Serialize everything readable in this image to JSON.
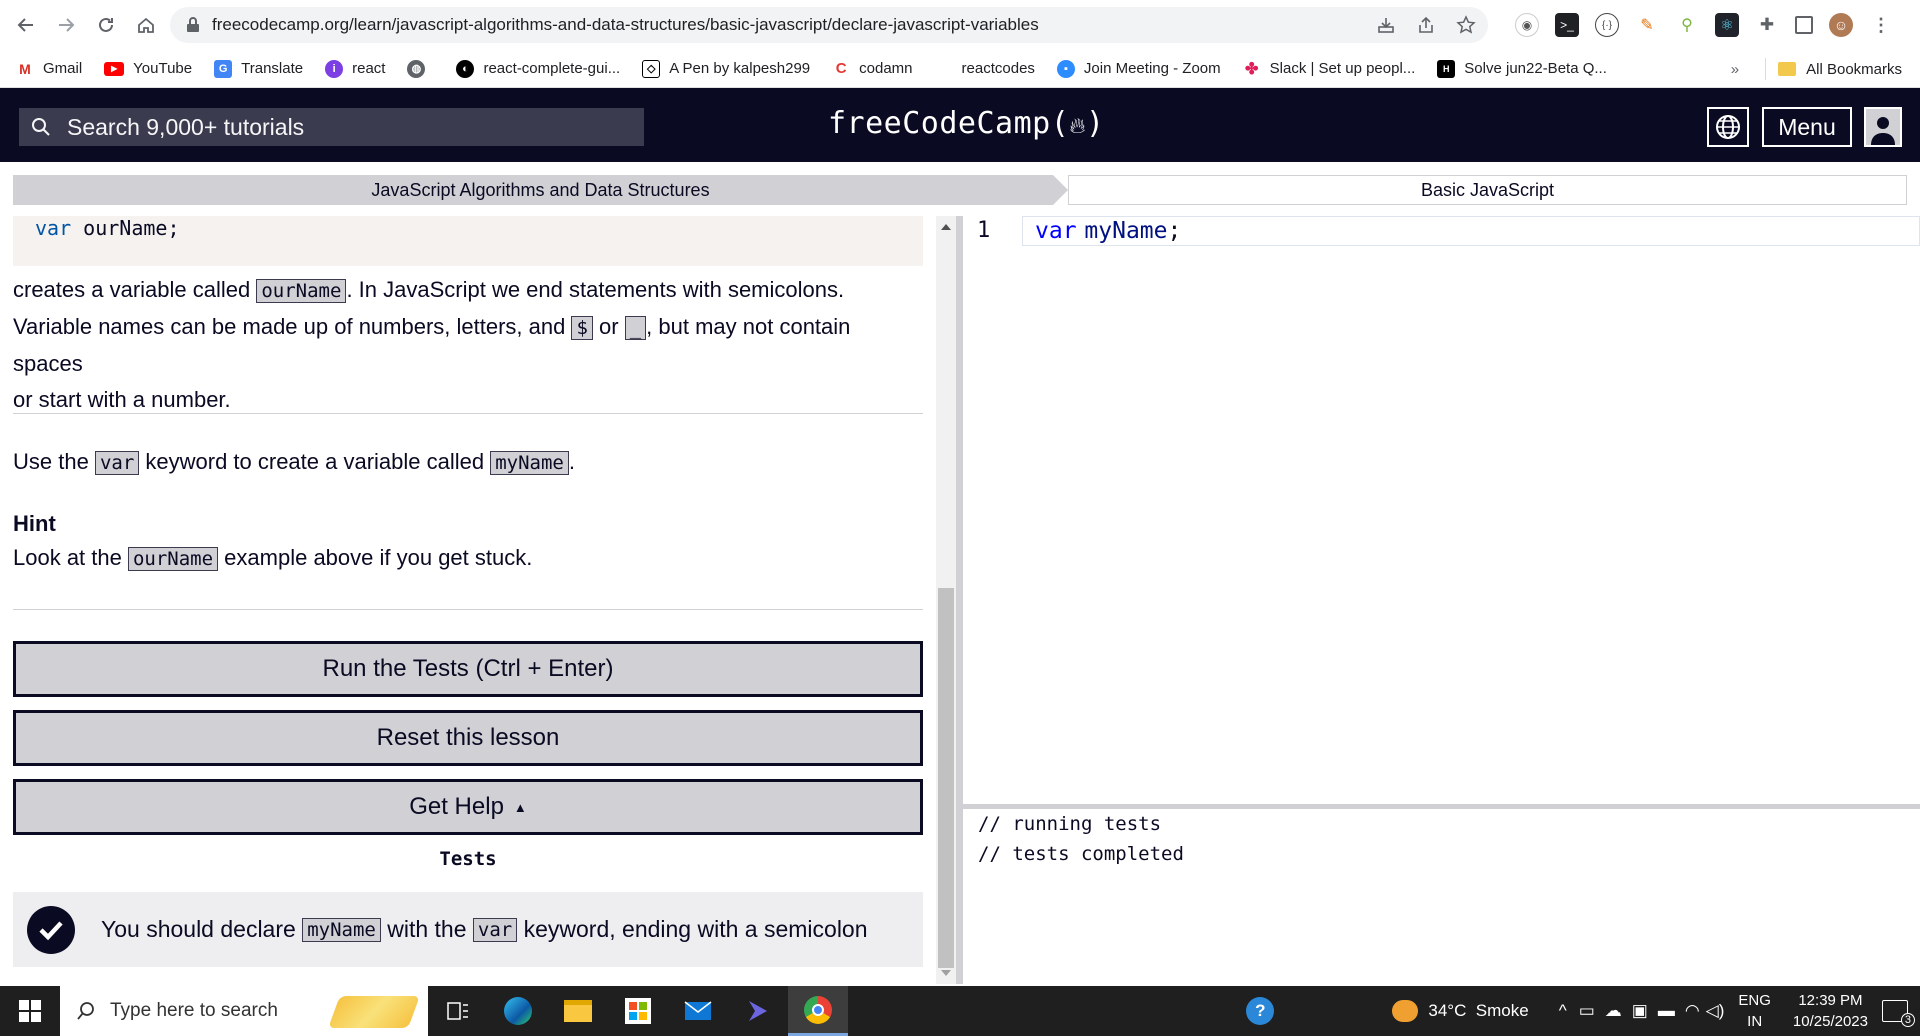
{
  "browser": {
    "url": "freecodecamp.org/learn/javascript-algorithms-and-data-structures/basic-javascript/declare-javascript-variables",
    "bookmarks": [
      {
        "label": "Gmail",
        "icon": "gmail-icon"
      },
      {
        "label": "YouTube",
        "icon": "youtube-icon"
      },
      {
        "label": "Translate",
        "icon": "translate-icon"
      },
      {
        "label": "react",
        "icon": "react-bookmark-icon"
      },
      {
        "label": "",
        "icon": "globe-icon"
      },
      {
        "label": "react-complete-gui...",
        "icon": "github-icon"
      },
      {
        "label": "A Pen by kalpesh299",
        "icon": "codepen-icon"
      },
      {
        "label": "codamn",
        "icon": "codamn-icon"
      },
      {
        "label": "reactcodes",
        "icon": "blank-icon"
      },
      {
        "label": "Join Meeting - Zoom",
        "icon": "zoom-icon"
      },
      {
        "label": "Slack | Set up peopl...",
        "icon": "slack-icon"
      },
      {
        "label": "Solve jun22-Beta Q...",
        "icon": "hackerearth-icon"
      }
    ],
    "more_bookmarks": "»",
    "all_bookmarks": "All Bookmarks"
  },
  "header": {
    "search_placeholder": "Search 9,000+ tutorials",
    "logo": "freeCodeCamp(🔥)",
    "logo_text": "freeCodeCamp",
    "menu_label": "Menu"
  },
  "breadcrumb": {
    "superblock": "JavaScript Algorithms and Data Structures",
    "block": "Basic JavaScript"
  },
  "lesson": {
    "example_keyword": "var",
    "example_code": "ourName;",
    "p1_a": "creates a variable called ",
    "p1_code": "ourName",
    "p1_b": ". In JavaScript we end statements with semicolons.",
    "p1_c": "Variable names can be made up of numbers, letters, and ",
    "p1_code2": "$",
    "p1_d": " or ",
    "p1_code3": "_",
    "p1_e": ", but may not contain spaces",
    "p1_f": "or start with a number.",
    "p2_a": "Use the ",
    "p2_code": "var",
    "p2_b": " keyword to create a variable called ",
    "p2_code2": "myName",
    "p2_c": ".",
    "hint_title": "Hint",
    "hint_a": "Look at the ",
    "hint_code": "ourName",
    "hint_b": " example above if you get stuck."
  },
  "buttons": {
    "run": "Run the Tests (Ctrl + Enter)",
    "reset": "Reset this lesson",
    "help": "Get Help",
    "help_caret": "▲"
  },
  "tests": {
    "title": "Tests",
    "item_a": "You should declare ",
    "item_code": "myName",
    "item_b": " with the ",
    "item_code2": "var",
    "item_c": " keyword, ending with a semicolon",
    "passed": true
  },
  "editor": {
    "line_number": "1",
    "keyword": "var",
    "identifier": "myName",
    "punct": ";"
  },
  "console": {
    "line1": "// running tests",
    "line2": "// tests completed"
  },
  "taskbar": {
    "search_placeholder": "Type here to search",
    "weather": "34°C  Smoke",
    "lang_top": "ENG",
    "lang_bottom": "IN",
    "time": "12:39 PM",
    "date": "10/25/2023",
    "notification_count": "3"
  },
  "colors": {
    "fcc_dark": "#0a0a23",
    "fcc_gray": "#d0d0d5",
    "fcc_search": "#3b3b4f",
    "code_keyword": "#0000ff"
  }
}
